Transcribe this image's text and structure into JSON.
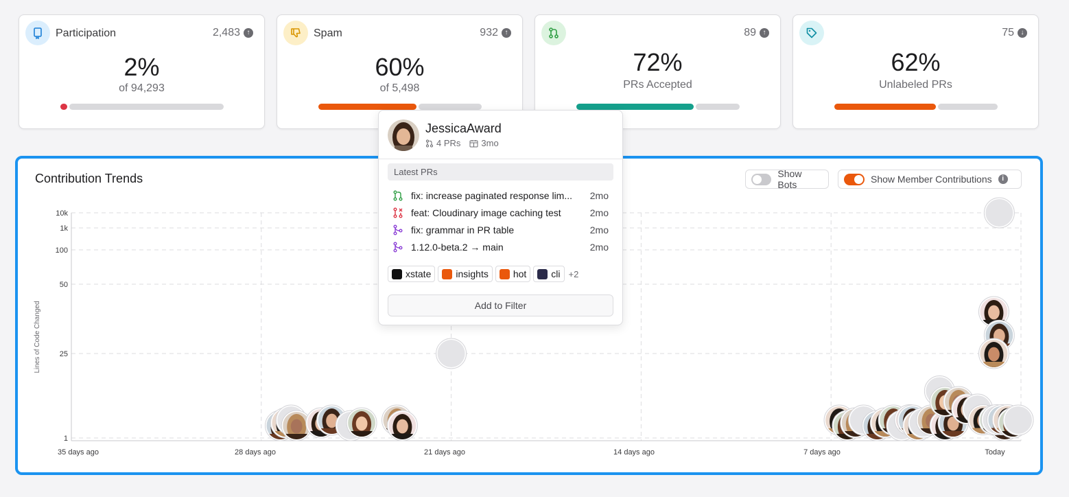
{
  "cards": [
    {
      "title": "Participation",
      "count": "2,483",
      "direction": "up",
      "pct": "2%",
      "sub": "of 94,293",
      "fill": 0.04,
      "fill_color": "#dc3545",
      "icon": "bookmark-icon",
      "icon_bg": "#dbeefd",
      "icon_color": "#1b7fd6"
    },
    {
      "title": "Spam",
      "count": "932",
      "direction": "up",
      "pct": "60%",
      "sub": "of 5,498",
      "fill": 0.6,
      "fill_color": "#ea580c",
      "icon": "thumbs-down-icon",
      "icon_bg": "#fdefc7",
      "icon_color": "#d99500"
    },
    {
      "title": "",
      "count": "89",
      "direction": "up",
      "pct": "72%",
      "sub": "PRs Accepted",
      "fill": 0.72,
      "fill_color": "#15a08c",
      "icon": "pull-request-icon",
      "icon_bg": "#dcf3df",
      "icon_color": "#2f9e44"
    },
    {
      "title": "",
      "count": "75",
      "direction": "down",
      "pct": "62%",
      "sub": "Unlabeled PRs",
      "fill": 0.62,
      "fill_color": "#ea580c",
      "icon": "tag-icon",
      "icon_bg": "#d9f3f6",
      "icon_color": "#0e8ea3"
    }
  ],
  "trends": {
    "title": "Contribution Trends",
    "show_bots": {
      "label": "Show Bots",
      "on": false
    },
    "show_member": {
      "label": "Show Member Contributions",
      "on": true
    }
  },
  "chart_data": {
    "type": "scatter",
    "title": "Contribution Trends",
    "ylabel": "Lines of Code Changed",
    "xlabel": "",
    "x_ticks": [
      "35 days ago",
      "28 days ago",
      "21 days ago",
      "14 days ago",
      "7 days ago",
      "Today"
    ],
    "y_ticks": [
      "10k",
      "1k",
      "100",
      "50",
      "25",
      "1"
    ],
    "y_scale": "log",
    "grid": true,
    "series": [
      {
        "points": [
          {
            "x": 27.3,
            "y": 1
          },
          {
            "x": 27.1,
            "y": 1
          },
          {
            "x": 26.9,
            "y": 1
          },
          {
            "x": 26.7,
            "y": 1
          },
          {
            "x": 25.8,
            "y": 1
          },
          {
            "x": 25.4,
            "y": 1
          },
          {
            "x": 24.7,
            "y": 1
          },
          {
            "x": 24.3,
            "y": 1
          },
          {
            "x": 23.0,
            "y": 1
          },
          {
            "x": 22.8,
            "y": 1
          },
          {
            "x": 21.0,
            "y": 25
          },
          {
            "x": 6.7,
            "y": 1
          },
          {
            "x": 6.4,
            "y": 1
          },
          {
            "x": 6.1,
            "y": 1
          },
          {
            "x": 5.8,
            "y": 1
          },
          {
            "x": 5.3,
            "y": 1
          },
          {
            "x": 5.0,
            "y": 1
          },
          {
            "x": 4.7,
            "y": 1
          },
          {
            "x": 4.4,
            "y": 1
          },
          {
            "x": 4.1,
            "y": 2
          },
          {
            "x": 4.0,
            "y": 1
          },
          {
            "x": 3.8,
            "y": 1
          },
          {
            "x": 3.6,
            "y": 1
          },
          {
            "x": 3.3,
            "y": 1
          },
          {
            "x": 2.8,
            "y": 1
          },
          {
            "x": 2.5,
            "y": 1
          },
          {
            "x": 3.0,
            "y": 6
          },
          {
            "x": 2.8,
            "y": 4
          },
          {
            "x": 2.3,
            "y": 4
          },
          {
            "x": 2.0,
            "y": 3
          },
          {
            "x": 1.6,
            "y": 3
          },
          {
            "x": 1.4,
            "y": 2
          },
          {
            "x": 1.0,
            "y": 1
          },
          {
            "x": 0.6,
            "y": 1
          },
          {
            "x": 0.9,
            "y": 2
          },
          {
            "x": 0.7,
            "y": 2
          },
          {
            "x": 0.5,
            "y": 2
          },
          {
            "x": 0.3,
            "y": 1
          },
          {
            "x": 0.1,
            "y": 1
          },
          {
            "x": 1.0,
            "y": 38
          },
          {
            "x": 0.8,
            "y": 30
          },
          {
            "x": 1.0,
            "y": 25
          },
          {
            "x": 0.8,
            "y": 10000
          }
        ]
      }
    ]
  },
  "popover": {
    "name": "JessicaAward",
    "prs": "4 PRs",
    "tenure": "3mo",
    "section": "Latest PRs",
    "items": [
      {
        "title": "fix: increase paginated response lim...",
        "time": "2mo",
        "state": "open"
      },
      {
        "title": "feat: Cloudinary image caching test",
        "time": "2mo",
        "state": "closed"
      },
      {
        "title": "fix: grammar in PR table",
        "time": "2mo",
        "state": "merged"
      },
      {
        "title": "1.12.0-beta.2 → main",
        "time": "2mo",
        "state": "merged"
      }
    ],
    "repos": [
      {
        "name": "xstate",
        "color": "#111111"
      },
      {
        "name": "insights",
        "color": "#ea580c"
      },
      {
        "name": "hot",
        "color": "#ea580c"
      },
      {
        "name": "cli",
        "color": "#2b2b4a"
      }
    ],
    "more": "+2",
    "button": "Add to Filter"
  }
}
